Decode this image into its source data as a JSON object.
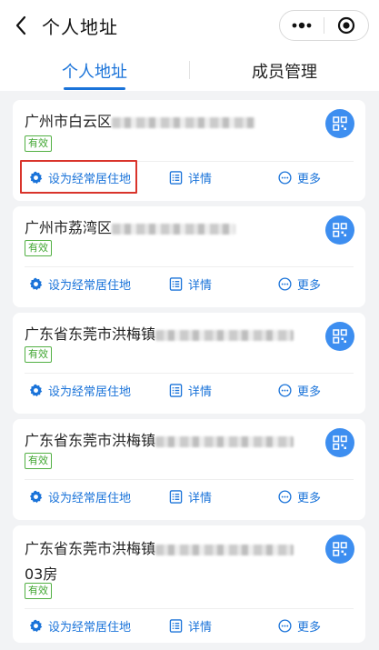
{
  "header": {
    "title": "个人地址",
    "back_icon": "back-chevron-icon",
    "capsule_icons": [
      "more-dots-icon",
      "close-target-icon"
    ]
  },
  "tabs": [
    {
      "label": "个人地址",
      "active": true
    },
    {
      "label": "成员管理",
      "active": false
    }
  ],
  "colors": {
    "accent": "#1a73d9",
    "badge_green": "#41a632",
    "qr_button": "#3d8ef0",
    "highlight_red": "#d9342b"
  },
  "cards": [
    {
      "address": "广州市白云区",
      "line2": "",
      "badge": "有效",
      "highlighted": true
    },
    {
      "address": "广州市荔湾区",
      "line2": "",
      "badge": "有效",
      "highlighted": false
    },
    {
      "address": "广东省东莞市洪梅镇",
      "line2": "",
      "badge": "有效",
      "highlighted": false
    },
    {
      "address": "广东省东莞市洪梅镇",
      "line2": "",
      "badge": "有效",
      "highlighted": false
    },
    {
      "address": "广东省东莞市洪梅镇",
      "line2": "03房",
      "badge": "有效",
      "highlighted": false
    }
  ],
  "actions": {
    "set_label": "设为经常居住地",
    "detail_label": "详情",
    "more_label": "更多",
    "set_icon": "gear-icon",
    "detail_icon": "list-icon",
    "more_icon": "more-circle-icon",
    "qr_icon": "qr-code-icon"
  }
}
